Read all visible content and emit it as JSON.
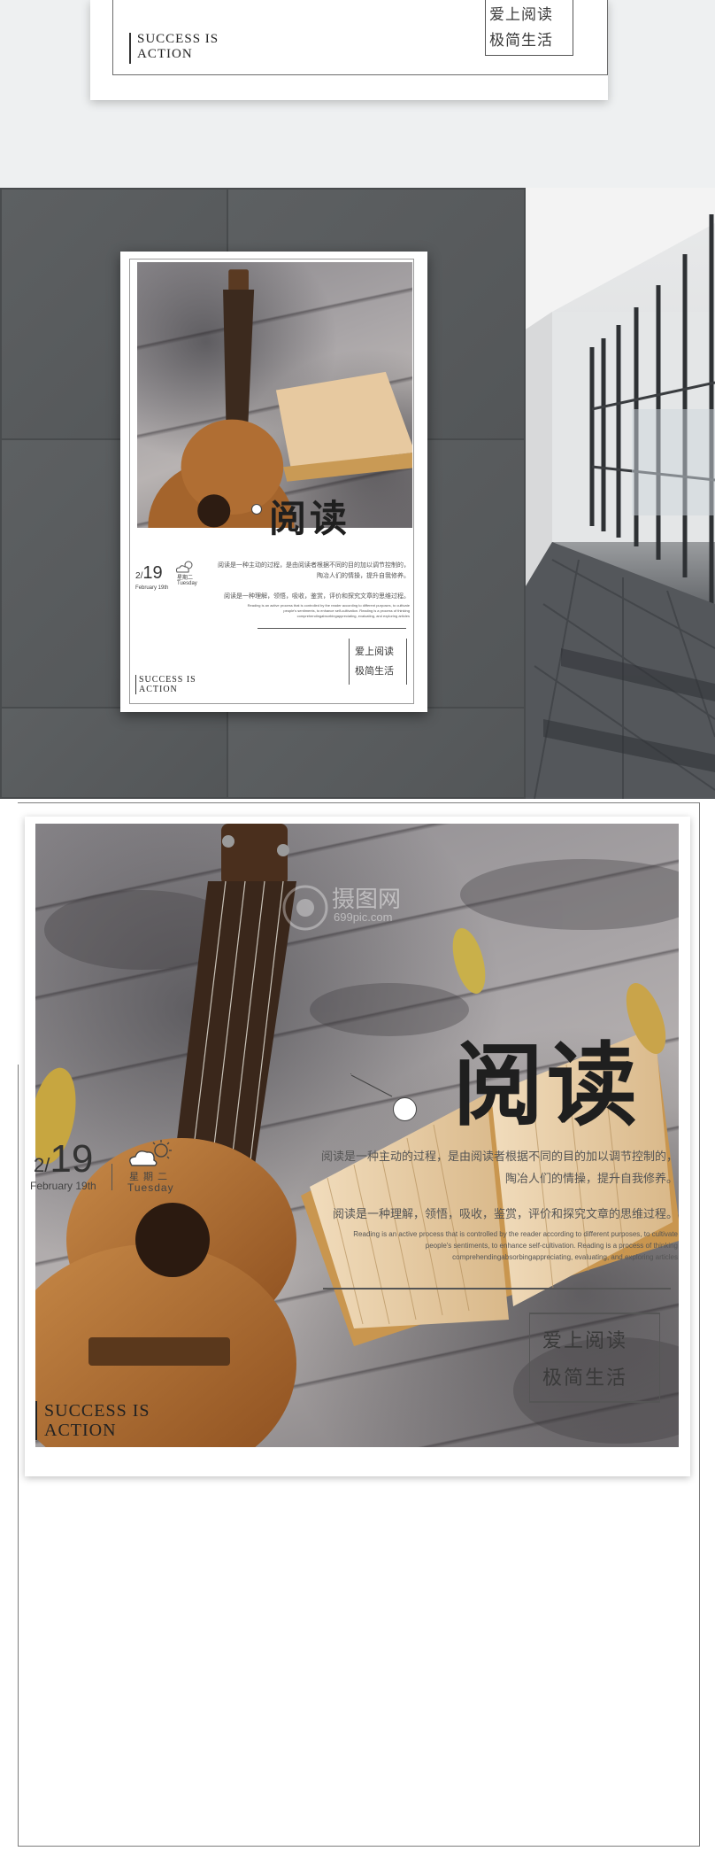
{
  "poster": {
    "title": "阅读",
    "date": {
      "month": "2",
      "day": "19",
      "label": "February 19th"
    },
    "weekday": {
      "cn": "星期二",
      "en": "Tuesday"
    },
    "weather_icon": "cloud-sun-icon",
    "para_cn_1": [
      "阅读是一种主动的过程，是由阅读者根据不同的目的加以调节控制的，",
      "陶冶人们的情操，提升自我修养。"
    ],
    "para_cn_2": "阅读是一种理解，领悟，吸收，鉴赏，评价和探究文章的思维过程。",
    "para_en": [
      "Reading is an active process that is controlled by the reader according to different purposes, to cultivate",
      "people's sentiments, to enhance self-cultivation. Reading is a process of thinking",
      "comprehendingabsorbingappreciating, evaluating, and exploring articles"
    ],
    "tagline": [
      "爱上阅读",
      "极简生活"
    ],
    "slogan": [
      "SUCCESS IS",
      "ACTION"
    ]
  },
  "watermark": {
    "brand": "摄图网",
    "url": "699pic.com",
    "icon": "logo-camera-icon"
  },
  "colors": {
    "wall": "#575a5c",
    "frame": "#7d7d7d",
    "text": "#333333",
    "background": "#ffffff"
  }
}
